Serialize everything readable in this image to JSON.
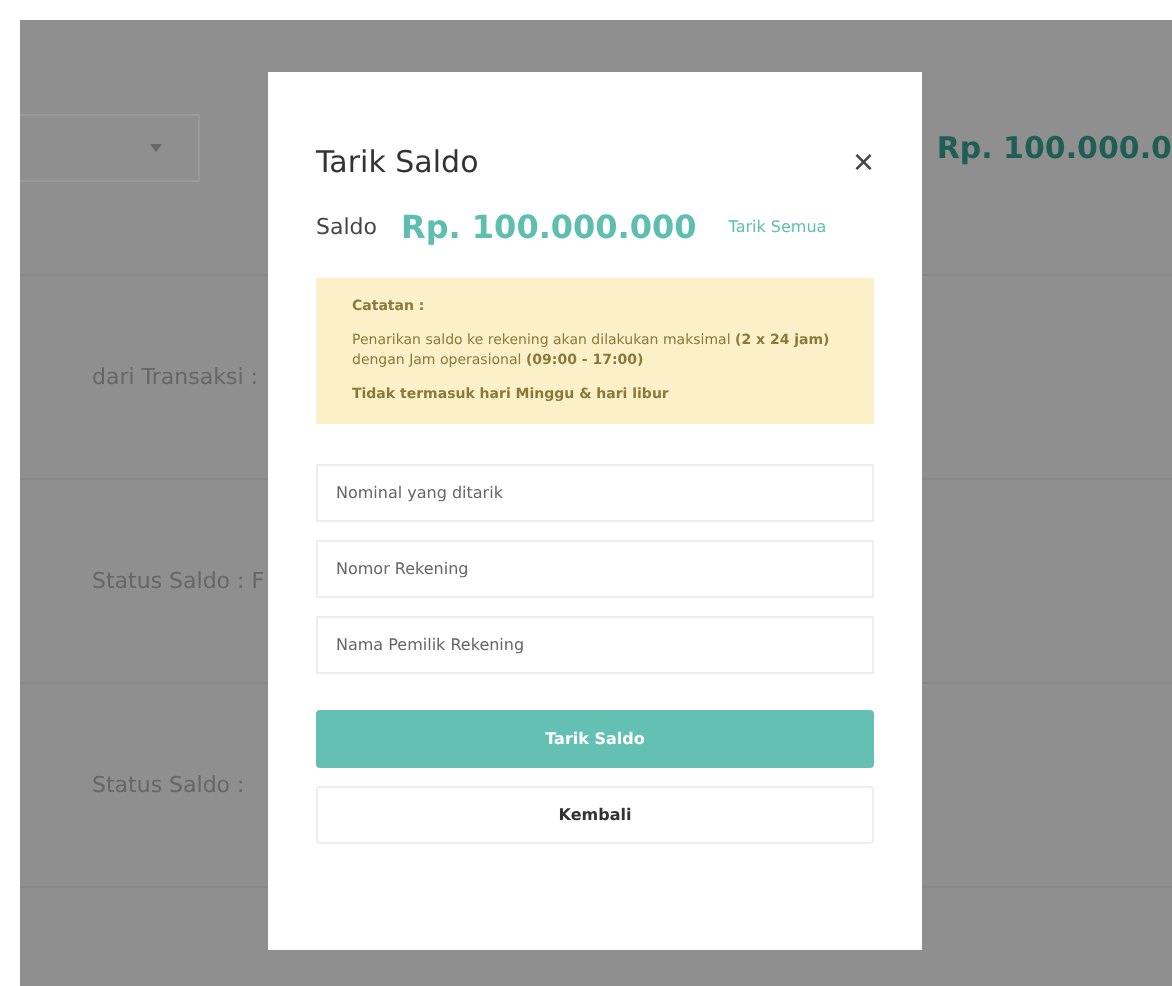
{
  "background": {
    "top_amount": "Rp. 100.000.0",
    "rows": [
      {
        "label": "dari Transaksi :"
      },
      {
        "label": "Status Saldo : F"
      },
      {
        "label": "Status Saldo :"
      }
    ]
  },
  "modal": {
    "title": "Tarik Saldo",
    "close": "×",
    "balance_label": "Saldo",
    "balance": "Rp. 100.000.000",
    "withdraw_all": "Tarik Semua",
    "note": {
      "heading": "Catatan :",
      "body": "Penarikan saldo ke rekening akan dilakukan maksimal **(2 x 24 jam)** dengan Jam operasional **(09:00 - 17:00)**",
      "footer": "Tidak termasuk hari Minggu & hari libur"
    },
    "fields": [
      {
        "placeholder": "Nominal yang ditarik"
      },
      {
        "placeholder": "Nomor Rekening"
      },
      {
        "placeholder": "Nama Pemilik Rekening"
      }
    ],
    "buttons": [
      {
        "label": "Tarik Saldo",
        "kind": "primary"
      },
      {
        "label": "Kembali",
        "kind": "secondary"
      }
    ]
  }
}
